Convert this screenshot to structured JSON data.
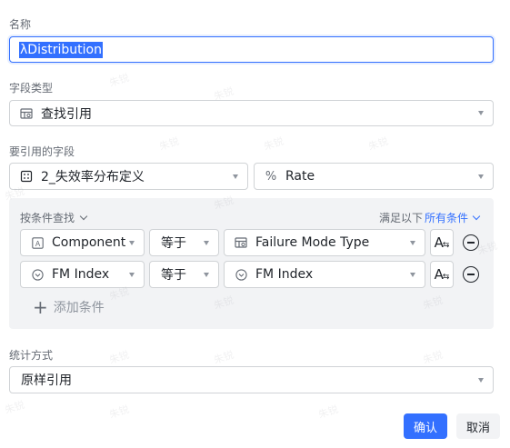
{
  "form": {
    "name_label": "名称",
    "name_value": "λDistribution",
    "field_type_label": "字段类型",
    "field_type_value": "查找引用",
    "ref_field_label": "要引用的字段",
    "ref_table_value": "2_失效率分布定义",
    "ref_field_value": "Rate",
    "stat_label": "统计方式",
    "stat_value": "原样引用"
  },
  "conditions": {
    "title": "按条件查找",
    "match_prefix": "满足以下",
    "match_mode": "所有条件",
    "add_label": "添加条件",
    "rows": [
      {
        "field": "Component",
        "field_icon": "text-field-icon",
        "operator": "等于",
        "value": "Failure Mode Type",
        "value_icon": "lookup-field-icon",
        "format_label": "A"
      },
      {
        "field": "FM Index",
        "field_icon": "circle-chevron-icon",
        "operator": "等于",
        "value": "FM Index",
        "value_icon": "circle-chevron-icon",
        "format_label": "A"
      }
    ]
  },
  "footer": {
    "confirm_label": "确认",
    "cancel_label": "取消"
  },
  "watermark": "朱锐",
  "colors": {
    "accent": "#3370ff",
    "panel": "#f2f3f5",
    "border": "#d0d3d6"
  }
}
